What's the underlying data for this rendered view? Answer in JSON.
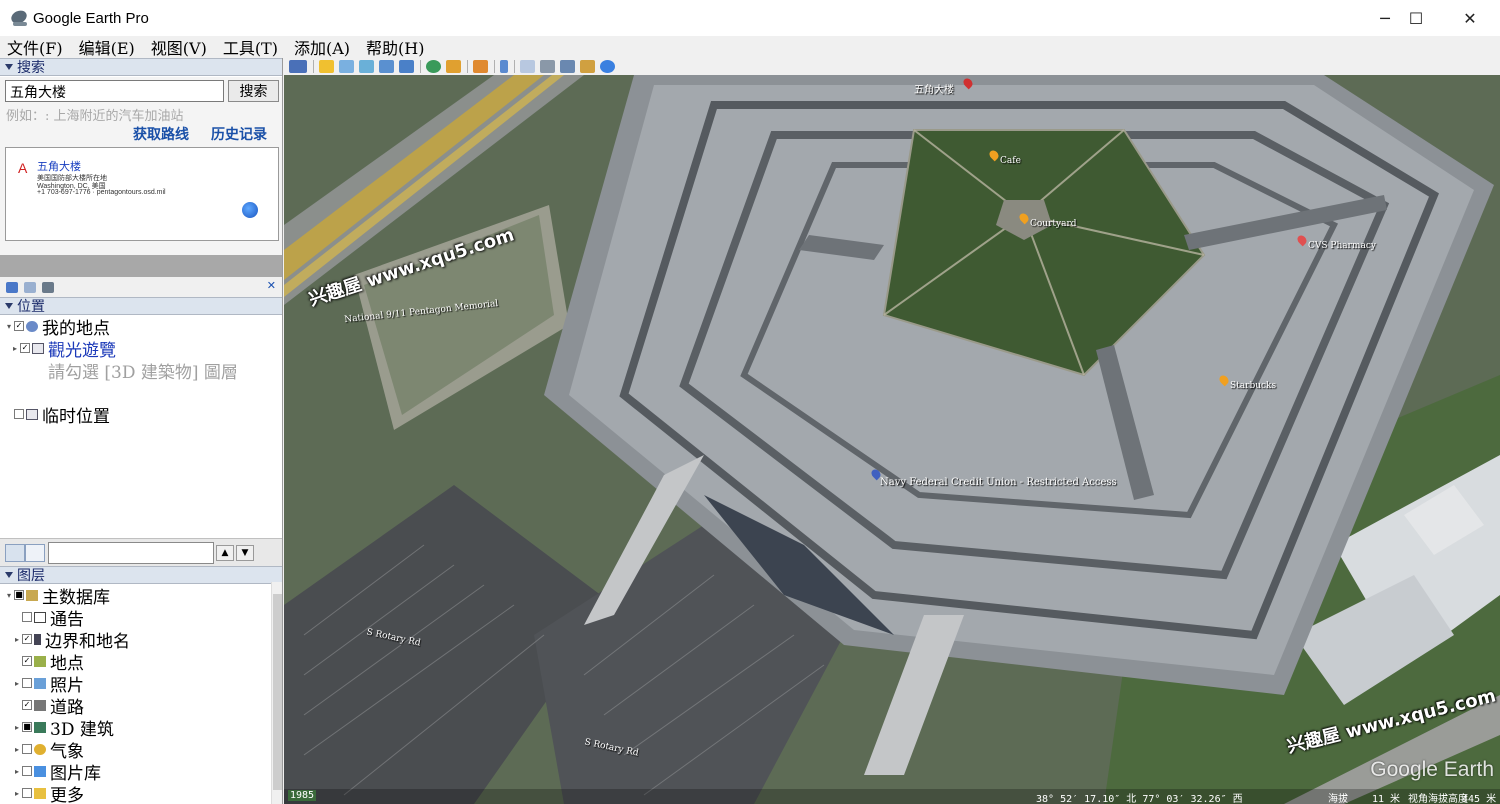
{
  "window": {
    "title": "Google Earth Pro",
    "minimize": "─",
    "maximize": "☐",
    "close": "✕"
  },
  "menu": [
    "文件(F)",
    "编辑(E)",
    "视图(V)",
    "工具(T)",
    "添加(A)",
    "帮助(H)"
  ],
  "search": {
    "header": "搜索",
    "query": "五角大楼",
    "button": "搜索",
    "example": "例如：: 上海附近的汽车加油站",
    "get_directions": "获取路线",
    "history": "历史记录",
    "result": {
      "marker": "A",
      "title": "五角大楼",
      "line1": "美国国防部大楼所在地",
      "line2": "Washington, DC, 美国",
      "line3": "+1 703-697-1776 · pentagontours.osd.mil"
    }
  },
  "places": {
    "header": "位置",
    "items": [
      {
        "label": "我的地点",
        "style": "normal"
      },
      {
        "label": "觀光遊覽",
        "style": "blue"
      },
      {
        "label": "請勾選 [3D 建築物] 圖層",
        "style": "grey"
      },
      {
        "label": "临时位置",
        "style": "normal"
      }
    ]
  },
  "layers": {
    "header": "图层",
    "items": [
      {
        "label": "主数据库"
      },
      {
        "label": "通告"
      },
      {
        "label": "边界和地名"
      },
      {
        "label": "地点"
      },
      {
        "label": "照片"
      },
      {
        "label": "道路"
      },
      {
        "label": "3D 建筑"
      },
      {
        "label": "气象"
      },
      {
        "label": "图片库"
      },
      {
        "label": "更多"
      }
    ]
  },
  "map": {
    "watermark1": "兴趣屋 www.xqu5.com",
    "watermark2": "兴趣屋 www.xqu5.com",
    "labels": {
      "pentagon": "五角大楼",
      "memorial": "National 9/11 Pentagon Memorial",
      "cafe": "Cafe",
      "courtyard": "Courtyard",
      "cvs": "CVS Pharmacy",
      "starbucks": "Starbucks",
      "navy": "Navy Federal Credit Union - Restricted Access",
      "rotary1": "S Rotary Rd",
      "rotary2": "S Rotary Rd"
    },
    "brand": "Google Earth",
    "status": {
      "year": "1985",
      "coords": "38° 52′ 17.10″ 北  77° 03′ 32.26″ 西",
      "elev_label": "海拔",
      "elev": "11 米",
      "eye_label": "视角海拔高度",
      "eye": "445 米"
    }
  },
  "colors": {
    "roof": "#8c9196",
    "roof_light": "#a3a8ad",
    "grass": "#3f5a32",
    "asphalt": "#4a4d50",
    "highway": "#c8a63a",
    "accent_blue": "#1a38b8"
  }
}
